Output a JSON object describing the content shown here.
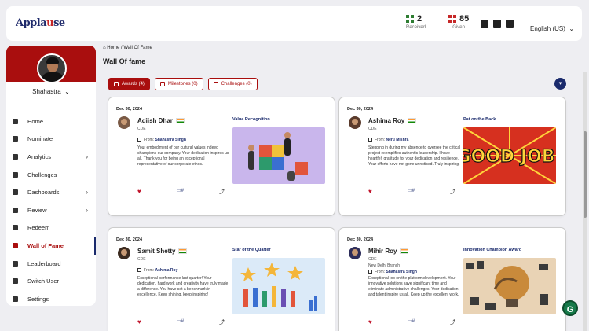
{
  "header": {
    "logo": {
      "prefix": "Appla",
      "mark": "u",
      "suffix": "se"
    },
    "stats": [
      {
        "value": "2",
        "label": "Received",
        "color": "#2e7d32"
      },
      {
        "value": "85",
        "label": "Given",
        "color": "#c62828"
      }
    ],
    "language": "English (US)"
  },
  "sidebar": {
    "user_name": "Shahastra",
    "items": [
      {
        "label": "Home",
        "icon": "home-icon"
      },
      {
        "label": "Nominate",
        "icon": "nominate-icon"
      },
      {
        "label": "Analytics",
        "icon": "analytics-icon",
        "chevron": "›"
      },
      {
        "label": "Challenges",
        "icon": "flag-icon"
      },
      {
        "label": "Dashboards",
        "icon": "dashboard-icon",
        "chevron": "›"
      },
      {
        "label": "Review",
        "icon": "review-icon",
        "chevron": "›"
      },
      {
        "label": "Redeem",
        "icon": "redeem-icon"
      },
      {
        "label": "Wall of Fame",
        "icon": "wall-of-fame-icon",
        "active": true
      },
      {
        "label": "Leaderboard",
        "icon": "leaderboard-icon"
      },
      {
        "label": "Switch User",
        "icon": "switch-user-icon"
      },
      {
        "label": "Settings",
        "icon": "settings-icon"
      }
    ]
  },
  "breadcrumb": {
    "home": "Home",
    "sep": "/",
    "current": "Wall Of Fame"
  },
  "page_title": "Wall Of fame",
  "tabs": [
    {
      "label": "Awards (4)",
      "active": true
    },
    {
      "label": "Milestones (0)"
    },
    {
      "label": "Challenges (0)"
    }
  ],
  "cards": [
    {
      "date": "Dec 30, 2024",
      "name": "Adiish Dhar",
      "role": "CDE",
      "from_label": "From:",
      "from": "Shahastra Singh",
      "message": "Your embodiment of our cultural values indeed champions our company. Your dedication inspires us all. Thank you for being an exceptional representative of our corporate ethos.",
      "award": "Value Recognition",
      "comment_count": "#"
    },
    {
      "date": "Dec 30, 2024",
      "name": "Ashima Roy",
      "role": "CDE",
      "from_label": "From:",
      "from": "Neru Mishra",
      "message": "Stepping in during my absence to oversee the critical project exemplifies authentic leadership. I have heartfelt gratitude for your dedication and resilience. Your efforts have not gone unnoticed. Truly inspiring.",
      "award": "Pat on the Back",
      "art_text": "GOOD JOB!",
      "comment_count": "#"
    },
    {
      "date": "Dec 30, 2024",
      "name": "Samit Shetty",
      "role": "CDE",
      "from_label": "From:",
      "from": "Ashima Roy",
      "message": "Exceptional performance last quarter! Your dedication, hard work and creativity have truly made a difference. You have set a benchmark in excellence. Keep shining, keep inspiring!",
      "award": "Star of the Quarter",
      "comment_count": "#"
    },
    {
      "date": "Dec 30, 2024",
      "name": "Mihir Roy",
      "role": "CDE",
      "branch": "New Delhi Branch",
      "from_label": "From:",
      "from": "Shahastra Singh",
      "message": "Exceptional job on the platform development. Your innovative solutions save significant time and eliminate administrative challenges. Your dedication and talent inspire us all. Keep up the excellent work.",
      "award": "Innovation Champion Award",
      "comment_count": "#"
    }
  ],
  "fab_label": "G",
  "colors": {
    "brand": "#a90e0e",
    "navy": "#1a2a6c",
    "accent_green": "#167a4a"
  }
}
